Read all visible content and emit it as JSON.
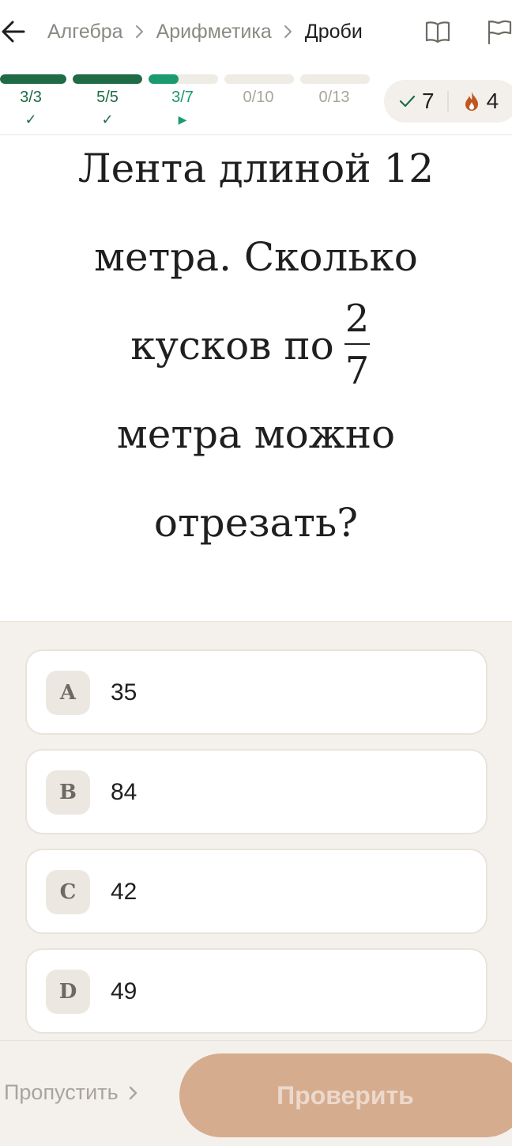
{
  "header": {
    "back_icon": "arrow-left-icon",
    "breadcrumbs": [
      "Алгебра",
      "Арифметика",
      "Дроби"
    ],
    "book_icon": "book-icon",
    "flag_icon": "flag-icon"
  },
  "progress": {
    "segments": [
      {
        "label": "3/3",
        "done": 3,
        "total": 3,
        "status": "complete",
        "mark": "✓"
      },
      {
        "label": "5/5",
        "done": 5,
        "total": 5,
        "status": "complete",
        "mark": "✓"
      },
      {
        "label": "3/7",
        "done": 3,
        "total": 7,
        "status": "current",
        "mark": "▶"
      },
      {
        "label": "0/10",
        "done": 0,
        "total": 10,
        "status": "pending",
        "mark": ""
      },
      {
        "label": "0/13",
        "done": 0,
        "total": 13,
        "status": "pending",
        "mark": ""
      }
    ],
    "colors": {
      "complete": "#1e6b45",
      "current": "#1a9a6f",
      "pending_track": "#efebe5",
      "pending_text": "#a8a49d"
    }
  },
  "stats": {
    "correct_count": "7",
    "correct_icon": "checkmark-icon",
    "streak_count": "4",
    "streak_icon": "flame-icon",
    "colors": {
      "check": "#1e6b45",
      "flame": "#c0571e"
    }
  },
  "question": {
    "line1": "Лента длиной 12",
    "line2": "метра. Сколько",
    "line3": "кусков по",
    "fraction": {
      "numerator": "2",
      "denominator": "7"
    },
    "line4": "метра можно",
    "line5": "отрезать?"
  },
  "options": [
    {
      "letter": "A",
      "text": "35"
    },
    {
      "letter": "B",
      "text": "84"
    },
    {
      "letter": "C",
      "text": "42"
    },
    {
      "letter": "D",
      "text": "49"
    }
  ],
  "footer": {
    "skip_label": "Пропустить",
    "skip_icon": "chevron-right-icon",
    "check_label": "Проверить",
    "check_color": "#d6ac8f"
  }
}
